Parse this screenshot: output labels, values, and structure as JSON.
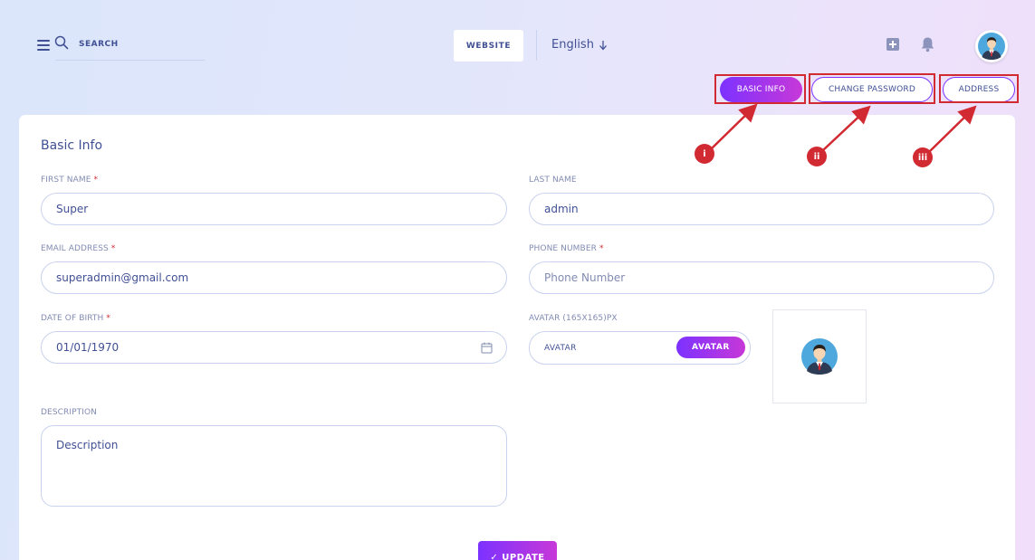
{
  "header": {
    "search_label": "SEARCH",
    "website_label": "WEBSITE",
    "language": "English"
  },
  "tabs": [
    {
      "label": "BASIC INFO",
      "active": true
    },
    {
      "label": "CHANGE PASSWORD",
      "active": false
    },
    {
      "label": "ADDRESS",
      "active": false
    }
  ],
  "annotations": [
    "i",
    "ii",
    "iii"
  ],
  "form": {
    "title": "Basic Info",
    "first_name": {
      "label": "FIRST NAME",
      "required": "*",
      "value": "Super"
    },
    "last_name": {
      "label": "LAST NAME",
      "value": "admin"
    },
    "email": {
      "label": "EMAIL ADDRESS",
      "required": "*",
      "value": "superadmin@gmail.com"
    },
    "phone": {
      "label": "PHONE NUMBER",
      "required": "*",
      "placeholder": "Phone Number"
    },
    "dob": {
      "label": "DATE OF BIRTH",
      "required": "*",
      "value": "01/01/1970"
    },
    "avatar": {
      "label": "AVATAR (165X165)PX",
      "placeholder": "AVATAR",
      "button": "AVATAR"
    },
    "description": {
      "label": "DESCRIPTION",
      "placeholder": "Description"
    },
    "submit": "✓ UPDATE"
  },
  "colors": {
    "accent_start": "#7c32ff",
    "accent_end": "#c738d8",
    "text": "#415094",
    "annotation": "#d12a32"
  }
}
